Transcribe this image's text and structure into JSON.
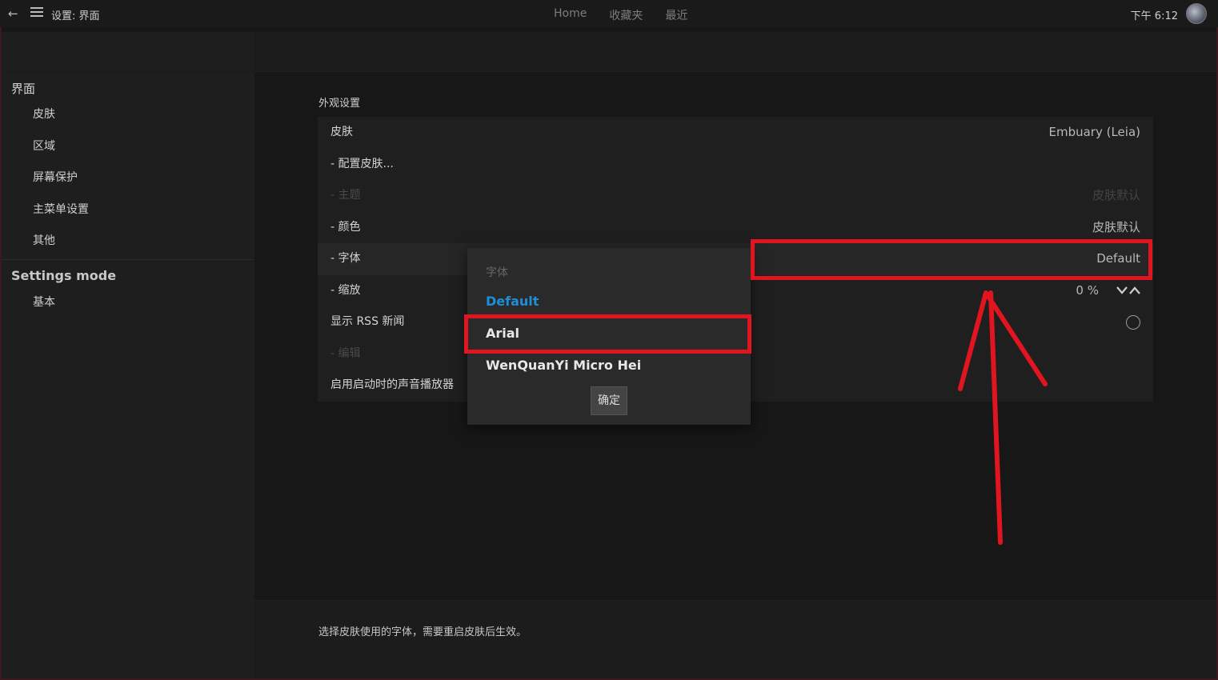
{
  "window": {
    "breadcrumb": "设置: 界面",
    "tabs": [
      "Home",
      "收藏夹",
      "最近"
    ],
    "clock": "下午 6:12"
  },
  "sidebar": {
    "group_title": "界面",
    "items": [
      {
        "label": "皮肤"
      },
      {
        "label": "区域"
      },
      {
        "label": "屏幕保护"
      },
      {
        "label": "主菜单设置"
      },
      {
        "label": "其他"
      }
    ],
    "mode_title": "Settings mode",
    "mode_items": [
      {
        "label": "基本"
      }
    ]
  },
  "main": {
    "section_title": "外观设置",
    "rows": [
      {
        "label": "皮肤",
        "value": "Embuary (Leia)"
      },
      {
        "label": "- 配置皮肤...",
        "value": ""
      },
      {
        "label": "- 主题",
        "value": "皮肤默认"
      },
      {
        "label": "- 颜色",
        "value": "皮肤默认"
      },
      {
        "label": "- 字体",
        "value": "Default"
      },
      {
        "label": "- 缩放",
        "value": "0 %"
      },
      {
        "label": "显示 RSS 新闻",
        "value": ""
      },
      {
        "label": "- 编辑",
        "value": ""
      },
      {
        "label": "启用启动时的声音播放器",
        "value": ""
      }
    ],
    "footer_text": "选择皮肤使用的字体，需要重启皮肤后生效。"
  },
  "popup": {
    "title": "字体",
    "options": [
      "Default",
      "Arial",
      "WenQuanYi Micro Hei"
    ],
    "selected": "Default",
    "ok_label": "确定"
  },
  "colors": {
    "accent": "#1e8fd6",
    "annotation": "#e0151f"
  }
}
